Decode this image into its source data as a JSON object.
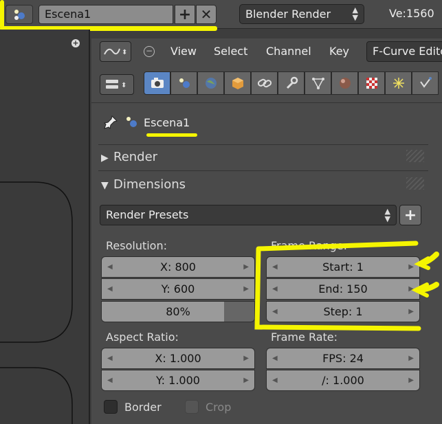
{
  "topbar": {
    "scene_name": "Escena1",
    "engine": "Blender Render",
    "version": "Ve:1560"
  },
  "editor_header": {
    "menus": [
      "View",
      "Select",
      "Channel",
      "Key"
    ],
    "mode": "F-Curve Edito"
  },
  "properties": {
    "breadcrumb": "Escena1",
    "panels": {
      "render": "Render",
      "dimensions": "Dimensions"
    },
    "presets": "Render Presets",
    "resolution": {
      "label": "Resolution:",
      "x": "X: 800",
      "y": "Y: 600",
      "percent_label": "80%",
      "percent": 80
    },
    "frame_range": {
      "label": "Frame Range:",
      "start": "Start: 1",
      "end": "End: 150",
      "step": "Step: 1"
    },
    "aspect": {
      "label": "Aspect Ratio:",
      "x": "X: 1.000",
      "y": "Y: 1.000"
    },
    "frame_rate": {
      "label": "Frame Rate:",
      "fps": "FPS: 24",
      "base": "/: 1.000"
    },
    "border": "Border",
    "crop": "Crop"
  },
  "colors": {
    "annotation": "#f5f500",
    "active_tab": "#5b86c4"
  }
}
